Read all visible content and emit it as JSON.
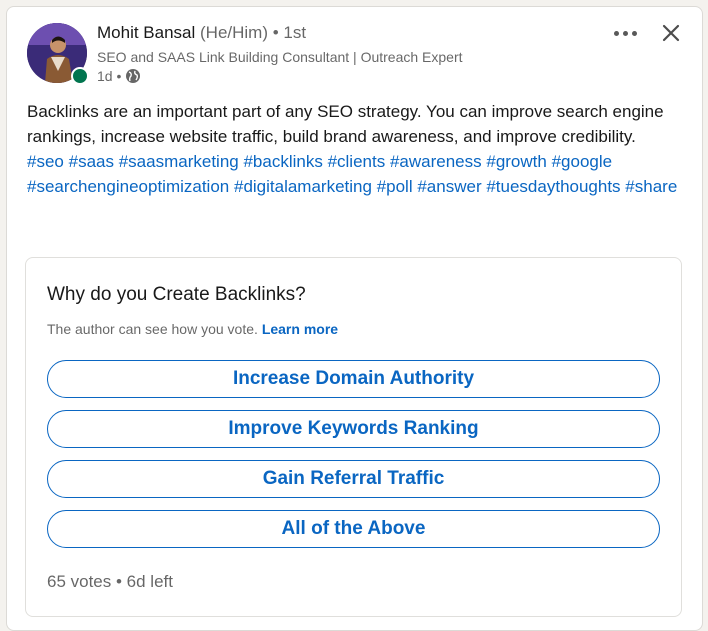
{
  "author": {
    "name": "Mohit Bansal",
    "pronouns": "(He/Him)",
    "degree": "• 1st",
    "headline": "SEO and SAAS Link Building Consultant | Outreach Expert",
    "time": "1d •",
    "visibility_icon": "globe-icon"
  },
  "post": {
    "text": "Backlinks are an important part of any SEO strategy. You can improve search engine rankings, increase website traffic, build brand awareness, and improve credibility.",
    "hashtags": [
      "#seo",
      "#saas",
      "#saasmarketing",
      "#backlinks",
      "#clients",
      "#awareness",
      "#growth",
      "#google",
      "#searchengineoptimization",
      "#digitalamarketing",
      "#poll",
      "#answer",
      "#tuesdaythoughts",
      "#share"
    ]
  },
  "poll": {
    "question": "Why do you Create Backlinks?",
    "note": "The author can see how you vote.",
    "learn_more": "Learn more",
    "options": [
      "Increase Domain Authority",
      "Improve Keywords Ranking",
      "Gain Referral Traffic",
      "All of the Above"
    ],
    "footer": "65 votes • 6d left"
  },
  "icons": {
    "more": "more-horizontal-icon",
    "close": "close-icon"
  },
  "colors": {
    "link": "#0a66c2",
    "online": "#01754f"
  }
}
